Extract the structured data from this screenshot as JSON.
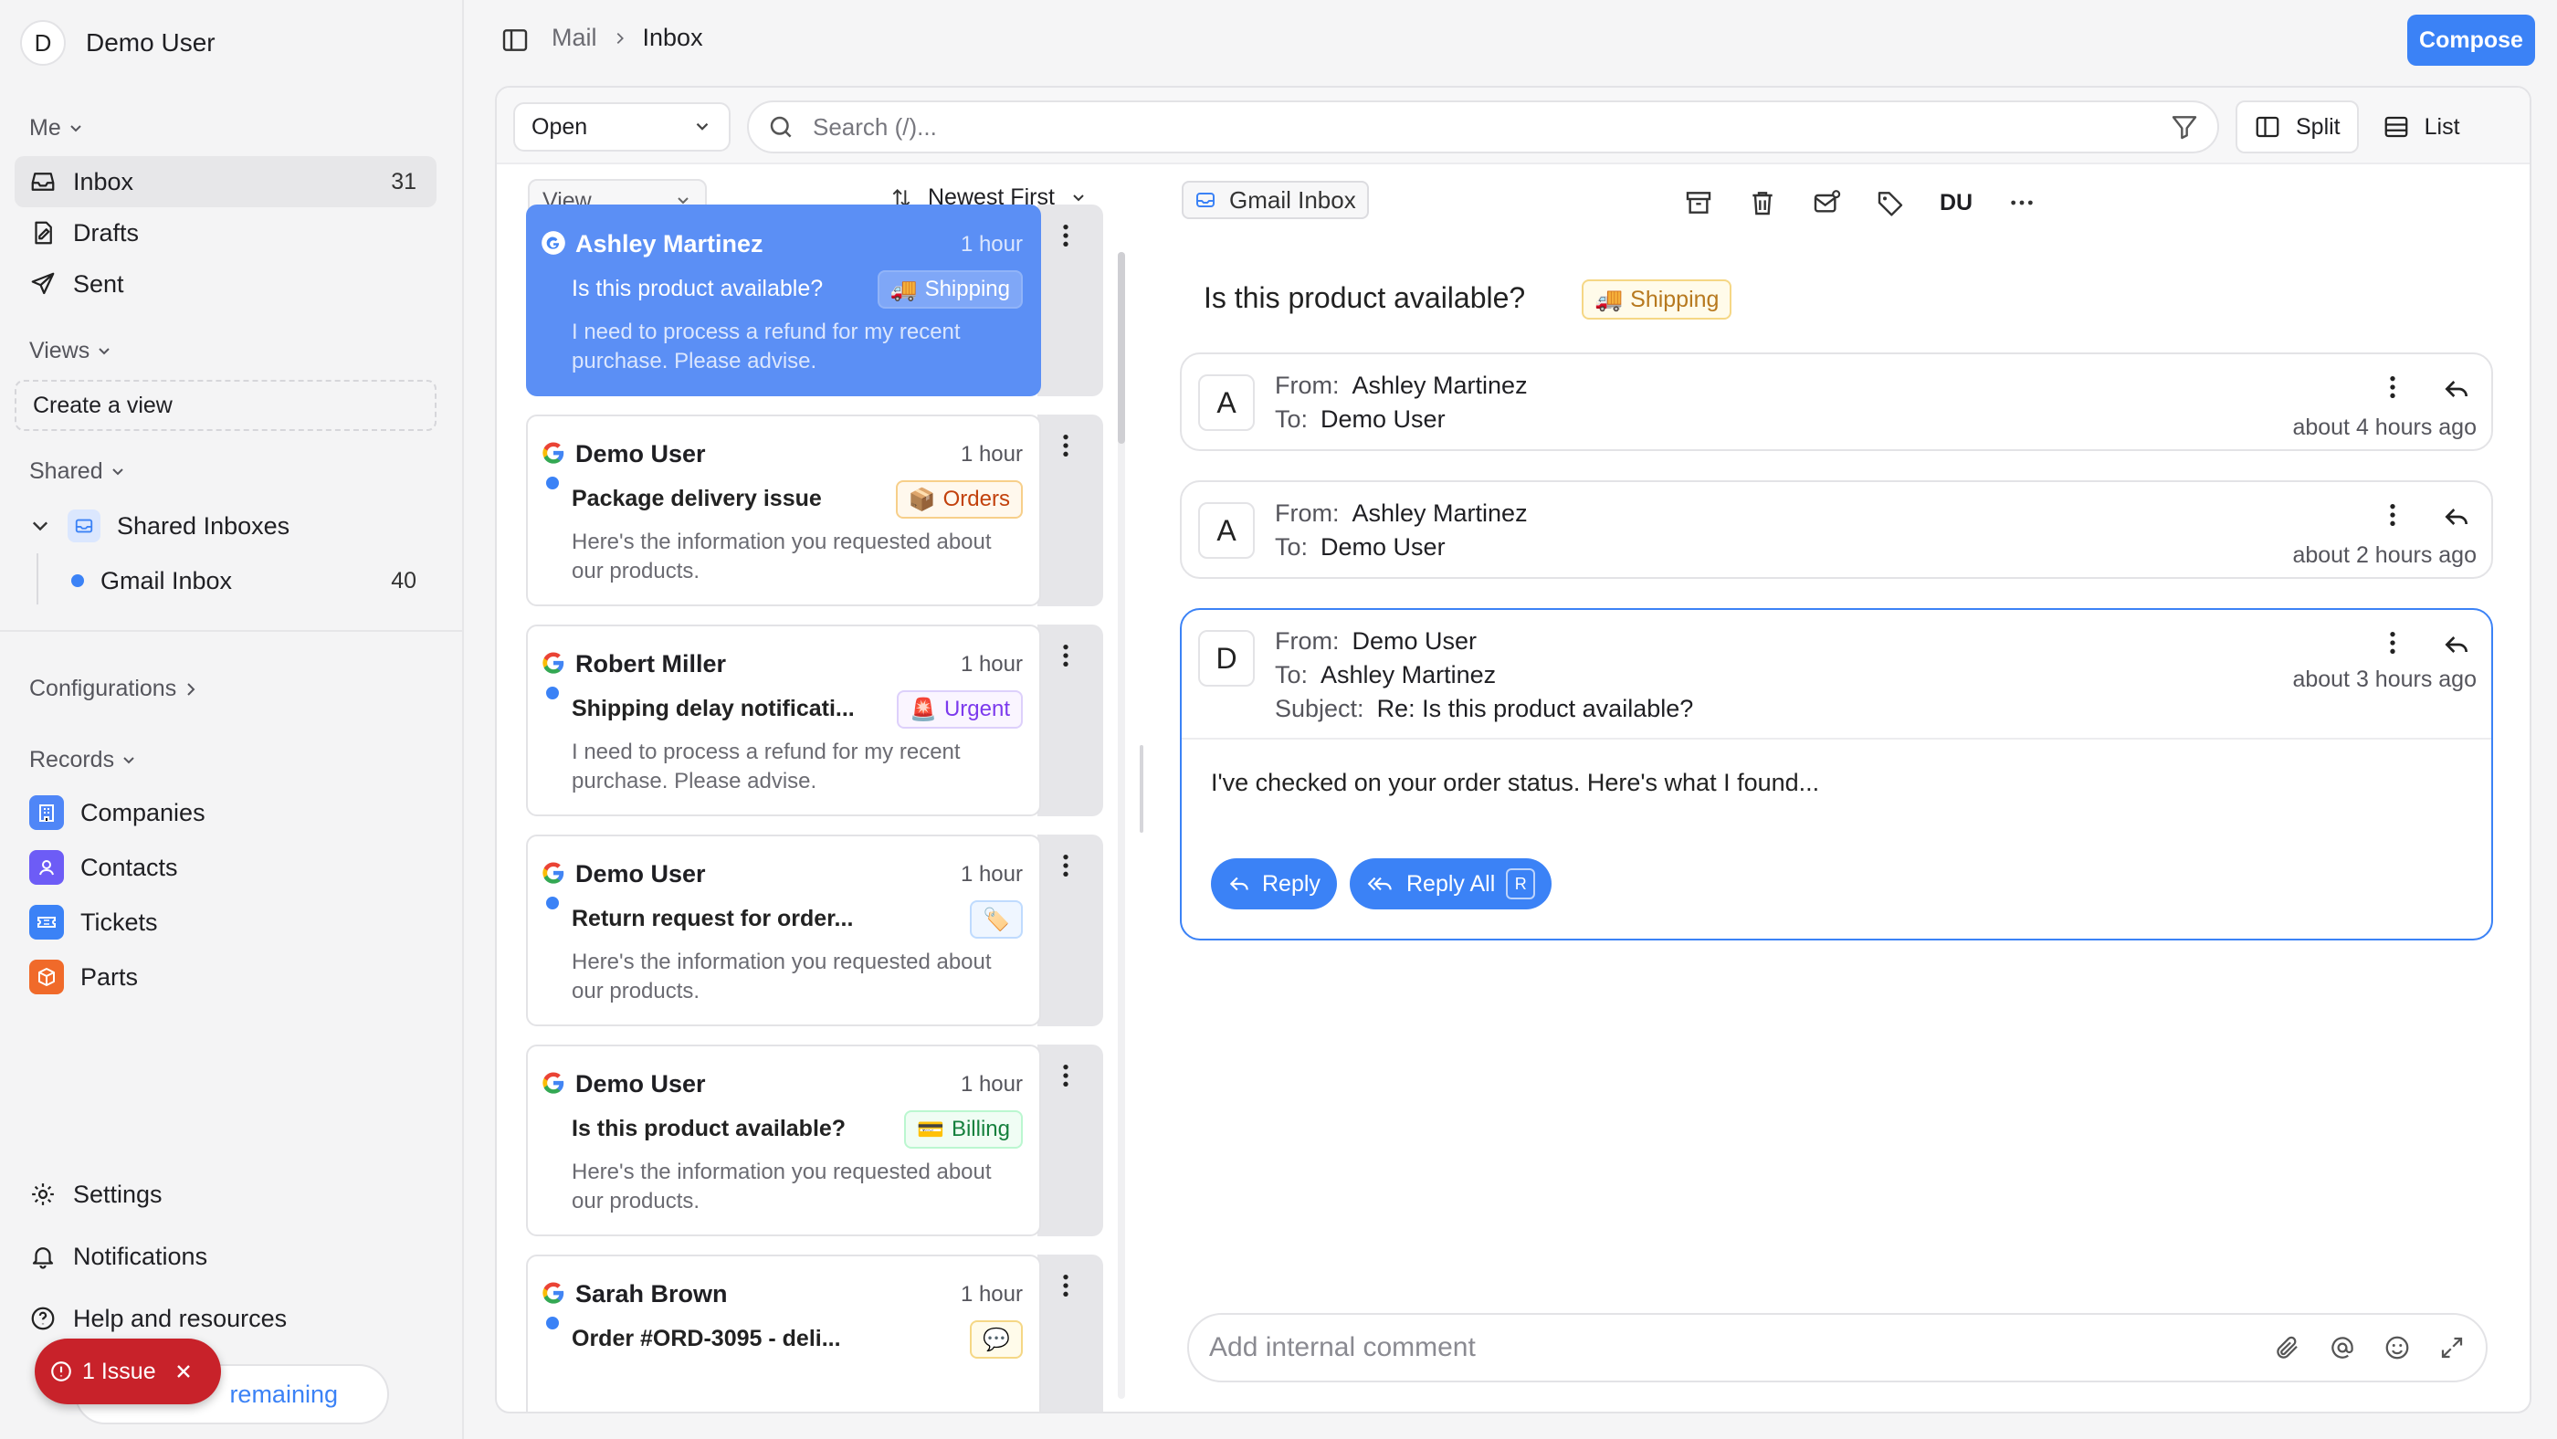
{
  "sidebar": {
    "user": {
      "initial": "D",
      "name": "Demo User"
    },
    "sections": {
      "me": "Me",
      "views": "Views",
      "shared": "Shared",
      "configurations": "Configurations",
      "records": "Records"
    },
    "me_items": [
      {
        "label": "Inbox",
        "count": "31"
      },
      {
        "label": "Drafts"
      },
      {
        "label": "Sent"
      }
    ],
    "create_view": "Create a view",
    "shared_inboxes": {
      "label": "Shared Inboxes",
      "child": "Gmail Inbox",
      "child_count": "40"
    },
    "records": [
      {
        "label": "Companies",
        "color": "#4f86f7"
      },
      {
        "label": "Contacts",
        "color": "#6d5cf6"
      },
      {
        "label": "Tickets",
        "color": "#3b82f6"
      },
      {
        "label": "Parts",
        "color": "#f06a2a"
      }
    ],
    "bottom": {
      "settings": "Settings",
      "notifications": "Notifications",
      "help": "Help and resources"
    },
    "trial_text": "remaining",
    "issue_badge": "1 Issue"
  },
  "header": {
    "breadcrumb": [
      "Mail",
      "Inbox"
    ],
    "compose_label": "Compose"
  },
  "toolbar": {
    "status_select": "Open",
    "search_placeholder": "Search (/)...",
    "split_label": "Split",
    "list_label": "List",
    "view_select": "View",
    "sort_label": "Newest First"
  },
  "emails": [
    {
      "sender": "Ashley Martinez",
      "time": "1 hour",
      "subject": "Is this product available?",
      "tag": "Shipping",
      "tag_icon": "🚚",
      "tag_color": "#b7791f",
      "tag_bg": "#fffbea",
      "tag_border": "#f5d785",
      "snippet": "I need to process a refund for my recent purchase. Please advise.",
      "selected": true,
      "unread": false
    },
    {
      "sender": "Demo User",
      "time": "1 hour",
      "subject": "Package delivery issue",
      "tag": "Orders",
      "tag_icon": "📦",
      "tag_color": "#c2410c",
      "tag_bg": "#fff8ed",
      "tag_border": "#f7cf8a",
      "snippet": "Here's the information you requested about our products.",
      "selected": false,
      "unread": true
    },
    {
      "sender": "Robert Miller",
      "time": "1 hour",
      "subject": "Shipping delay notificati...",
      "tag": "Urgent",
      "tag_icon": "🚨",
      "tag_color": "#7c3aed",
      "tag_bg": "#faf5ff",
      "tag_border": "#ddd0fb",
      "snippet": "I need to process a refund for my recent purchase. Please advise.",
      "selected": false,
      "unread": true
    },
    {
      "sender": "Demo User",
      "time": "1 hour",
      "subject": "Return request for order...",
      "tag": "",
      "tag_icon": "🏷️",
      "tag_color": "#3b82f6",
      "tag_bg": "#eff6ff",
      "tag_border": "#bfdbfe",
      "snippet": "Here's the information you requested about our products.",
      "selected": false,
      "unread": true
    },
    {
      "sender": "Demo User",
      "time": "1 hour",
      "subject": "Is this product available?",
      "tag": "Billing",
      "tag_icon": "💳",
      "tag_color": "#15803d",
      "tag_bg": "#f0fdf4",
      "tag_border": "#bbf7d0",
      "snippet": "Here's the information you requested about our products.",
      "selected": false,
      "unread": false
    },
    {
      "sender": "Sarah Brown",
      "time": "1 hour",
      "subject": "Order #ORD-3095 - deli...",
      "tag": "",
      "tag_icon": "💬",
      "tag_color": "#b7791f",
      "tag_bg": "#fffbea",
      "tag_border": "#f5d785",
      "snippet": "",
      "selected": false,
      "unread": true
    }
  ],
  "thread": {
    "inbox_chip": "Gmail Inbox",
    "assignee": "DU",
    "title": "Is this product available?",
    "tag": "Shipping",
    "tag_icon": "🚚",
    "messages": [
      {
        "initial": "A",
        "from_label": "From:",
        "from": "Ashley Martinez",
        "to_label": "To:",
        "to": "Demo User",
        "time": "about 4 hours ago"
      },
      {
        "initial": "A",
        "from_label": "From:",
        "from": "Ashley Martinez",
        "to_label": "To:",
        "to": "Demo User",
        "time": "about 2 hours ago"
      },
      {
        "initial": "D",
        "from_label": "From:",
        "from": "Demo User",
        "to_label": "To:",
        "to": "Ashley Martinez",
        "subject_label": "Subject:",
        "subject": "Re: Is this product available?",
        "time": "about 3 hours ago",
        "body": "I've checked on your order status. Here's what I found..."
      }
    ],
    "reply_label": "Reply",
    "reply_all_label": "Reply All",
    "reply_all_shortcut": "R",
    "comment_placeholder": "Add internal comment"
  }
}
